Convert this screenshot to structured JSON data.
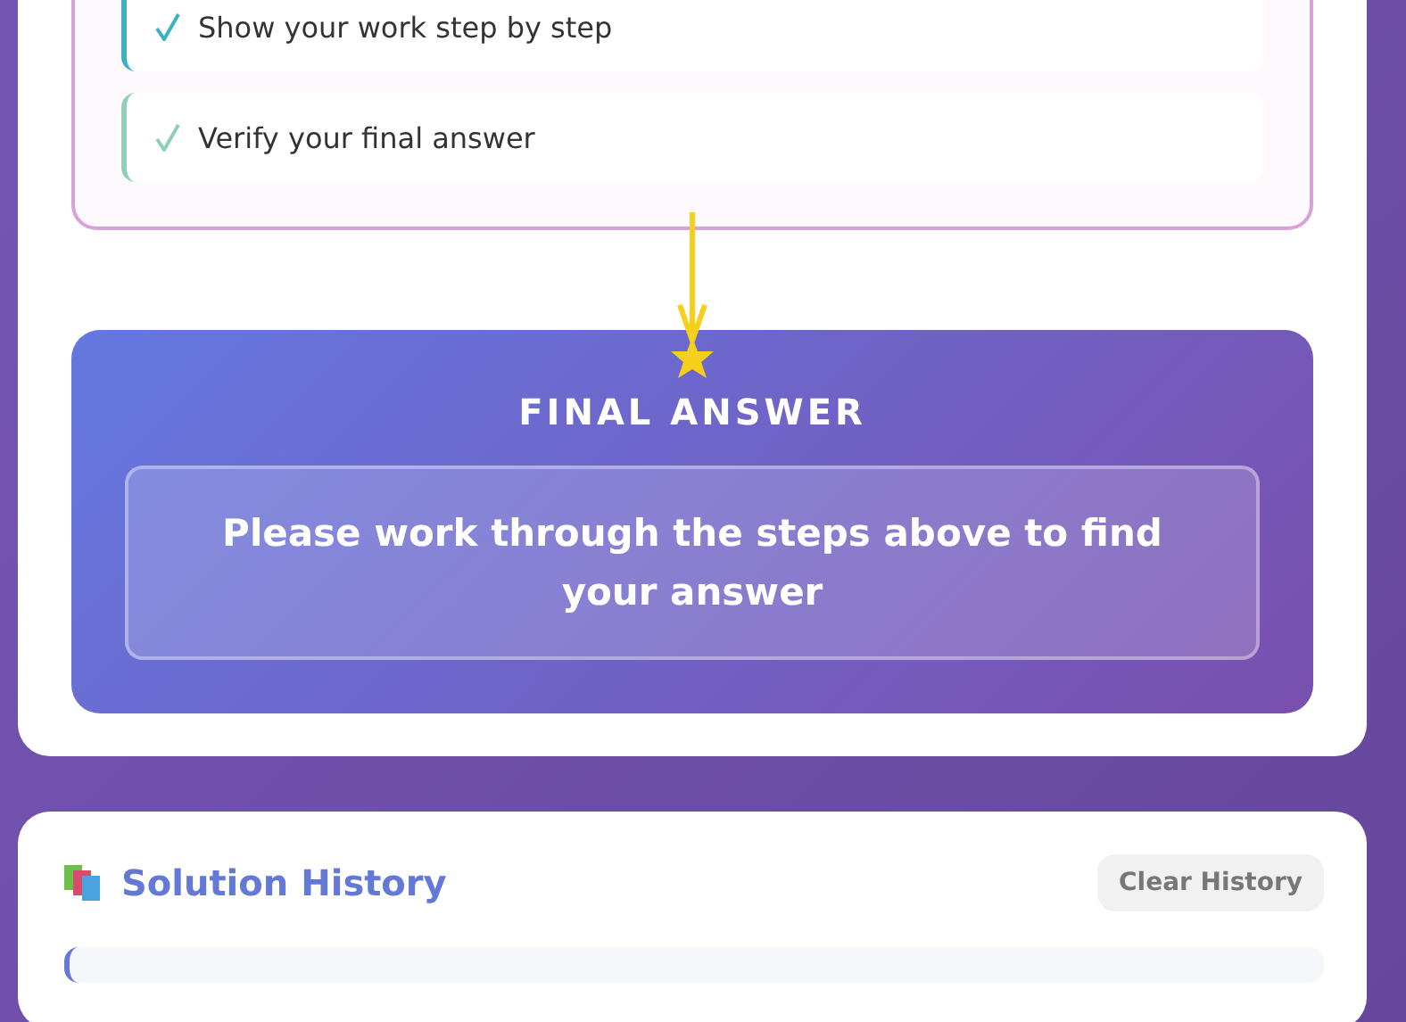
{
  "tips": [
    {
      "text": "Show your work step by step",
      "color": "#3fb0c4"
    },
    {
      "text": "Verify your final answer",
      "color": "#8fd0b4"
    }
  ],
  "final_answer": {
    "title": "FINAL ANSWER",
    "message": "Please work through the steps above to find your answer"
  },
  "history": {
    "title": "Solution History",
    "clear_button": "Clear History"
  }
}
